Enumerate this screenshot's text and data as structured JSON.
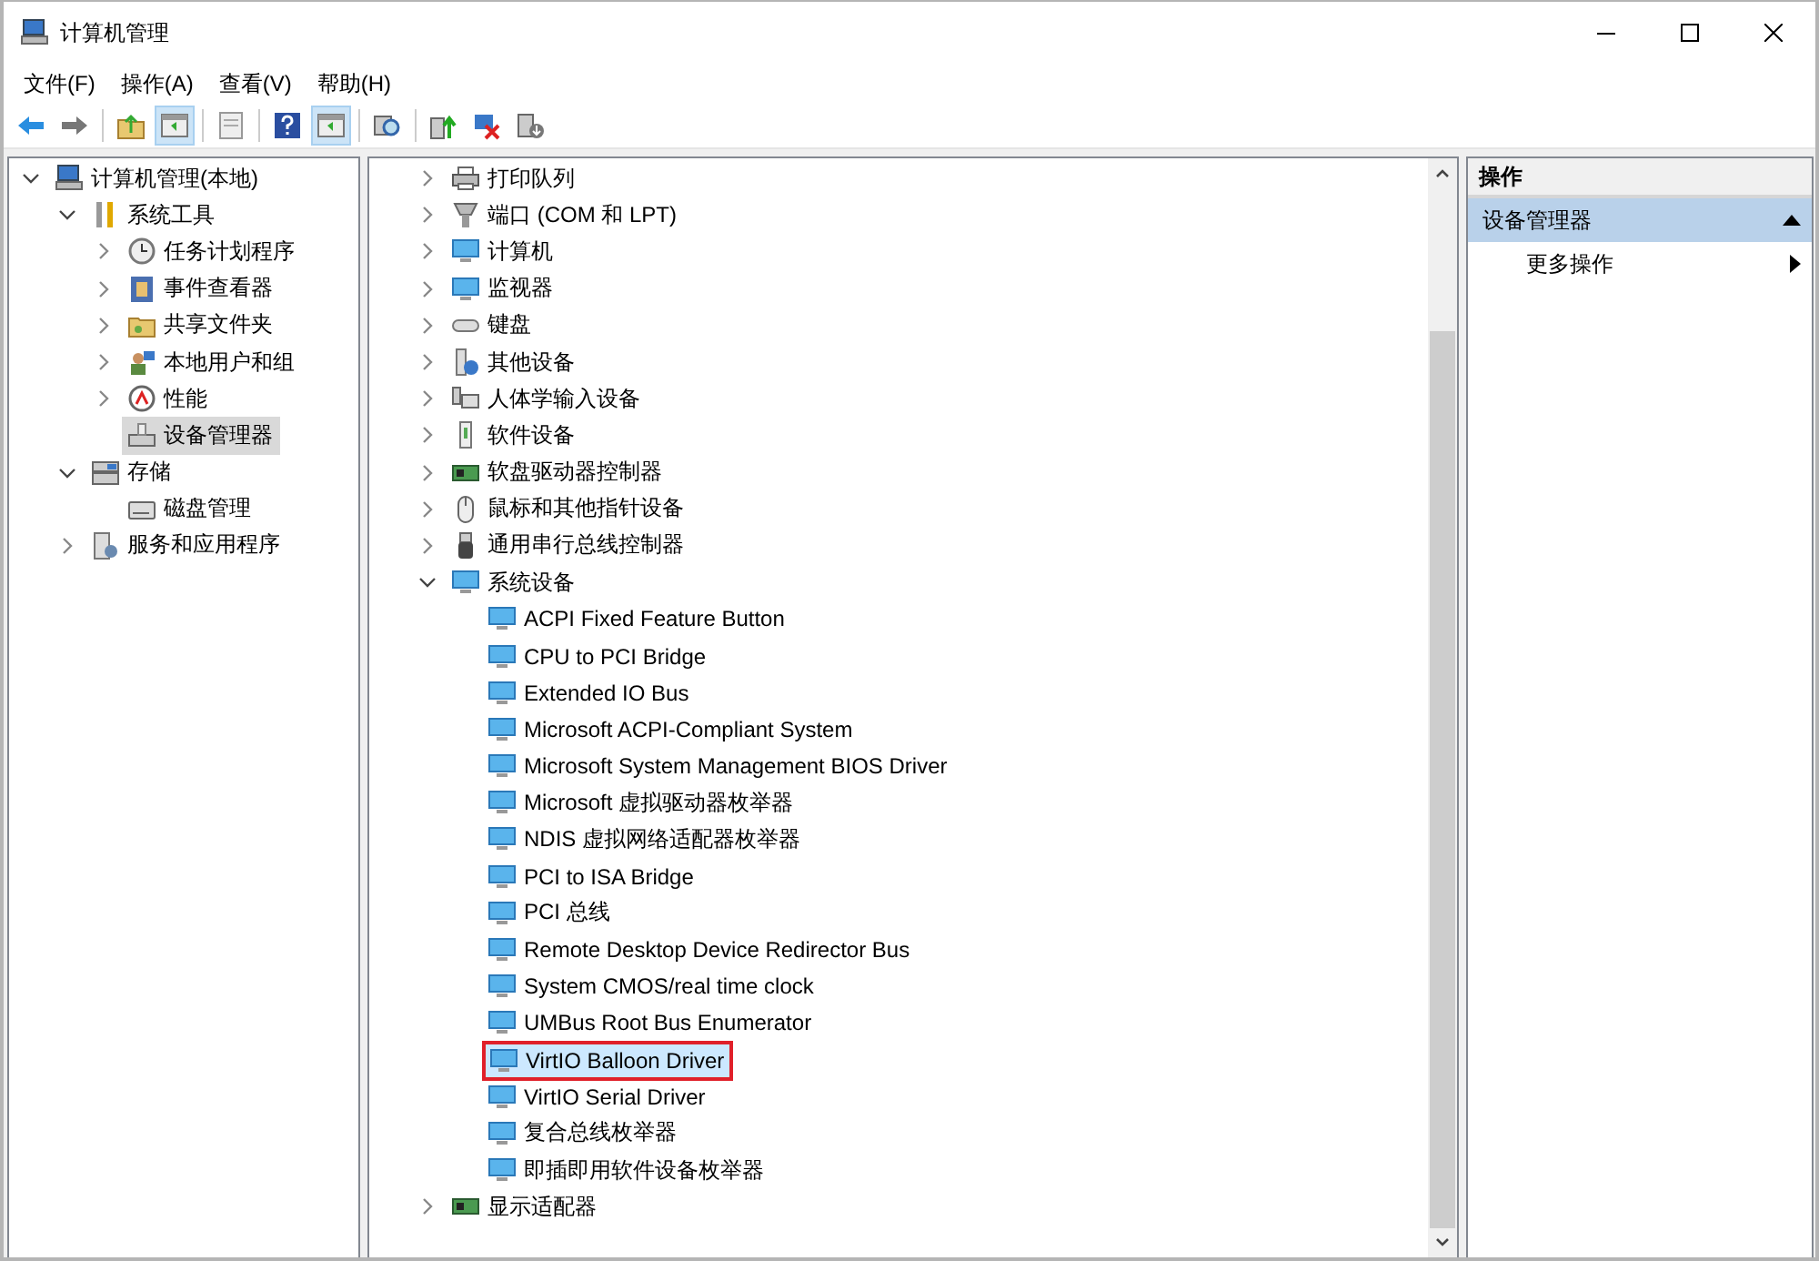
{
  "window": {
    "title": "计算机管理"
  },
  "menu": [
    "文件(F)",
    "操作(A)",
    "查看(V)",
    "帮助(H)"
  ],
  "toolbar": [
    {
      "kind": "back",
      "pressed": false
    },
    {
      "kind": "forward",
      "pressed": false
    },
    {
      "kind": "separator"
    },
    {
      "kind": "upfolder",
      "pressed": false
    },
    {
      "kind": "pane",
      "pressed": true
    },
    {
      "kind": "separator"
    },
    {
      "kind": "properties",
      "pressed": false
    },
    {
      "kind": "separator"
    },
    {
      "kind": "help",
      "pressed": false
    },
    {
      "kind": "pane",
      "pressed": true
    },
    {
      "kind": "separator"
    },
    {
      "kind": "scan",
      "pressed": false
    },
    {
      "kind": "separator"
    },
    {
      "kind": "update",
      "pressed": false
    },
    {
      "kind": "remove",
      "pressed": false
    },
    {
      "kind": "install",
      "pressed": false
    }
  ],
  "console_tree": [
    {
      "label": "计算机管理(本地)",
      "kind": "computer",
      "expanded": true,
      "selected": false,
      "children": [
        {
          "label": "系统工具",
          "kind": "tools",
          "expanded": true,
          "selected": false,
          "children": [
            {
              "label": "任务计划程序",
              "kind": "clock",
              "expanded": false,
              "selected": false
            },
            {
              "label": "事件查看器",
              "kind": "log",
              "expanded": false,
              "selected": false
            },
            {
              "label": "共享文件夹",
              "kind": "folder",
              "expanded": false,
              "selected": false
            },
            {
              "label": "本地用户和组",
              "kind": "users",
              "expanded": false,
              "selected": false
            },
            {
              "label": "性能",
              "kind": "gauge",
              "expanded": false,
              "selected": false
            },
            {
              "label": "设备管理器",
              "kind": "device",
              "selected": true
            }
          ]
        },
        {
          "label": "存储",
          "kind": "storage",
          "expanded": true,
          "selected": false,
          "children": [
            {
              "label": "磁盘管理",
              "kind": "disk",
              "selected": false
            }
          ]
        },
        {
          "label": "服务和应用程序",
          "kind": "services",
          "expanded": false,
          "selected": false
        }
      ]
    }
  ],
  "device_tree": [
    {
      "label": "打印队列",
      "kind": "printer",
      "expanded": false,
      "selected": false,
      "outlined": false
    },
    {
      "label": "端口 (COM 和 LPT)",
      "kind": "port",
      "expanded": false,
      "selected": false,
      "outlined": false
    },
    {
      "label": "计算机",
      "kind": "monitor",
      "expanded": false,
      "selected": false,
      "outlined": false
    },
    {
      "label": "监视器",
      "kind": "monitor",
      "expanded": false,
      "selected": false,
      "outlined": false
    },
    {
      "label": "键盘",
      "kind": "keyboard",
      "expanded": false,
      "selected": false,
      "outlined": false
    },
    {
      "label": "其他设备",
      "kind": "unknown",
      "expanded": false,
      "selected": false,
      "outlined": false
    },
    {
      "label": "人体学输入设备",
      "kind": "hid",
      "expanded": false,
      "selected": false,
      "outlined": false
    },
    {
      "label": "软件设备",
      "kind": "software",
      "expanded": false,
      "selected": false,
      "outlined": false
    },
    {
      "label": "软盘驱动器控制器",
      "kind": "card",
      "expanded": false,
      "selected": false,
      "outlined": false
    },
    {
      "label": "鼠标和其他指针设备",
      "kind": "mouse",
      "expanded": false,
      "selected": false,
      "outlined": false
    },
    {
      "label": "通用串行总线控制器",
      "kind": "usb",
      "expanded": false,
      "selected": false,
      "outlined": false
    },
    {
      "label": "系统设备",
      "kind": "monitor",
      "expanded": true,
      "selected": false,
      "outlined": false,
      "children": [
        {
          "label": "ACPI Fixed Feature Button",
          "kind": "monitor",
          "selected": false,
          "outlined": false
        },
        {
          "label": "CPU to PCI Bridge",
          "kind": "monitor",
          "selected": false,
          "outlined": false
        },
        {
          "label": "Extended IO Bus",
          "kind": "monitor",
          "selected": false,
          "outlined": false
        },
        {
          "label": "Microsoft ACPI-Compliant System",
          "kind": "monitor",
          "selected": false,
          "outlined": false
        },
        {
          "label": "Microsoft System Management BIOS Driver",
          "kind": "monitor",
          "selected": false,
          "outlined": false
        },
        {
          "label": "Microsoft 虚拟驱动器枚举器",
          "kind": "monitor",
          "selected": false,
          "outlined": false
        },
        {
          "label": "NDIS 虚拟网络适配器枚举器",
          "kind": "monitor",
          "selected": false,
          "outlined": false
        },
        {
          "label": "PCI to ISA Bridge",
          "kind": "monitor",
          "selected": false,
          "outlined": false
        },
        {
          "label": "PCI 总线",
          "kind": "monitor",
          "selected": false,
          "outlined": false
        },
        {
          "label": "Remote Desktop Device Redirector Bus",
          "kind": "monitor",
          "selected": false,
          "outlined": false
        },
        {
          "label": "System CMOS/real time clock",
          "kind": "monitor",
          "selected": false,
          "outlined": false
        },
        {
          "label": "UMBus Root Bus Enumerator",
          "kind": "monitor",
          "selected": false,
          "outlined": false
        },
        {
          "label": "VirtIO Balloon Driver",
          "kind": "monitor",
          "selected": true,
          "outlined": true
        },
        {
          "label": "VirtIO Serial Driver",
          "kind": "monitor",
          "selected": false,
          "outlined": false
        },
        {
          "label": "复合总线枚举器",
          "kind": "monitor",
          "selected": false,
          "outlined": false
        },
        {
          "label": "即插即用软件设备枚举器",
          "kind": "monitor",
          "selected": false,
          "outlined": false
        }
      ]
    },
    {
      "label": "显示适配器",
      "kind": "card",
      "expanded": false,
      "selected": false,
      "outlined": false
    }
  ],
  "actions": {
    "header": "操作",
    "sections": [
      {
        "title": "设备管理器",
        "expanded": true,
        "items": [
          {
            "label": "更多操作"
          }
        ]
      }
    ]
  }
}
